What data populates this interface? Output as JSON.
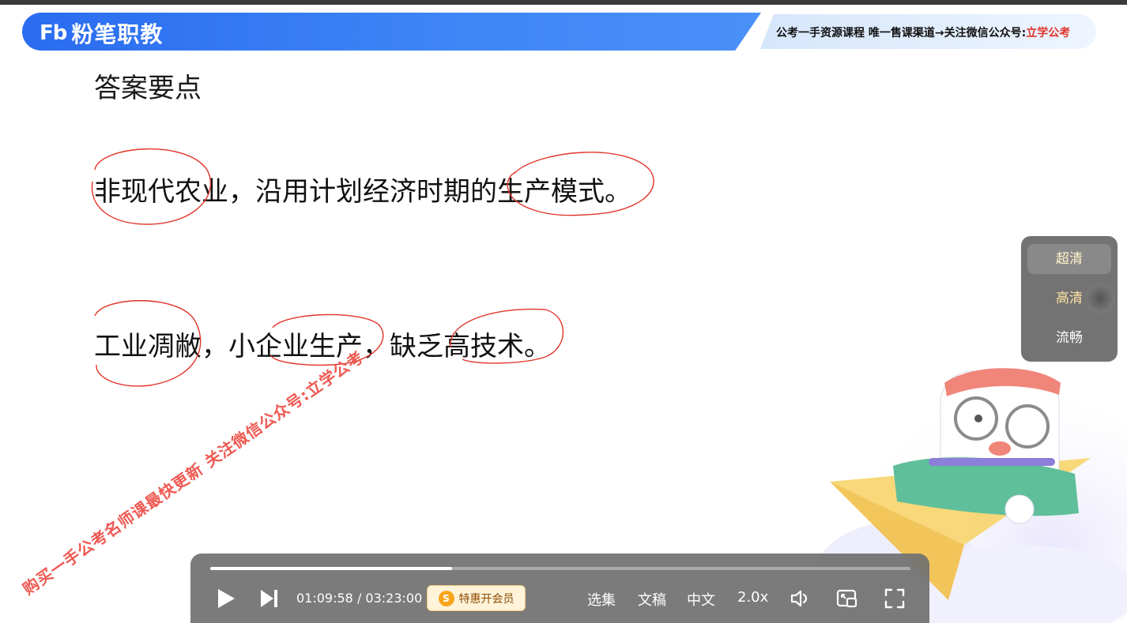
{
  "header": {
    "logo_mark": "Fb",
    "logo_text": "粉笔职教",
    "promo_prefix": "公考一手资源课程 唯一售课渠道→关注微信公众号:",
    "promo_highlight": "立学公考"
  },
  "slide": {
    "heading": "答案要点",
    "points": [
      "非现代农业，沿用计划经济时期的生产模式。",
      "工业凋敝，小企业生产，缺乏高技术。"
    ]
  },
  "watermark": "购买一手公考名师课最快更新 关注微信公众号:立学公考",
  "quality_menu": {
    "options": [
      "超清",
      "高清",
      "流畅"
    ],
    "selected": "超清"
  },
  "player": {
    "current_time": "01:09:58",
    "separator": " / ",
    "total_time": "03:23:00",
    "progress": 0.345,
    "vip_label": "特惠开会员",
    "episodes_label": "选集",
    "doc_label": "文稿",
    "subtitle_label": "中文",
    "speed_label": "2.0x"
  },
  "colors": {
    "brand_blue": "#2a6cf0",
    "annotation_red": "#e0352b",
    "watermark_red": "#ee5a52"
  }
}
